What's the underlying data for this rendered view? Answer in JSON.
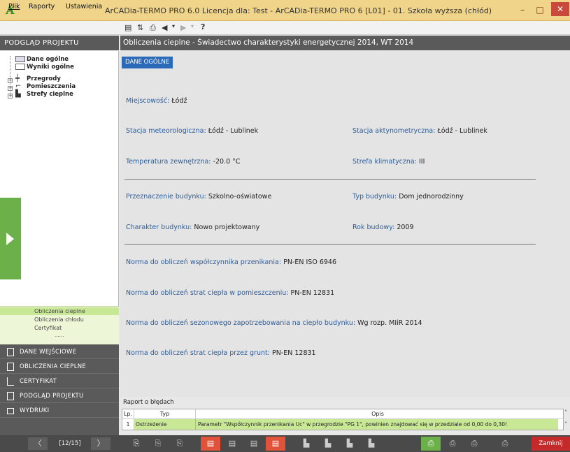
{
  "window": {
    "title": "ArCADia-TERMO PRO 6.0 Licencja dla: Test - ArCADia-TERMO PRO 6 [L01] - 01. Szkoła wyższa (chłód)",
    "minimize": "–",
    "maximize": "□",
    "close": "✕"
  },
  "menu": {
    "items": [
      "Plik",
      "Raporty",
      "Ustawienia"
    ]
  },
  "toolbar": {
    "icons": [
      "save-icon",
      "swap-icon",
      "preview-icon",
      "undo-icon",
      "undo-dropdown-icon",
      "redo-icon",
      "redo-dropdown-icon",
      "help-icon"
    ],
    "help_label": "?"
  },
  "sidebar": {
    "header": "PODGLĄD PROJEKTU",
    "tree": [
      {
        "label": "Dane ogólne",
        "icon": "table-icon"
      },
      {
        "label": "Wyniki ogólne",
        "icon": "chart-icon"
      },
      {
        "label": "Przegrody",
        "icon": "partition-icon"
      },
      {
        "label": "Pomieszczenia",
        "icon": "room-icon"
      },
      {
        "label": "Strefy cieplne",
        "icon": "zone-icon"
      }
    ],
    "sub_items": [
      "Obliczenia cieplne",
      "Obliczenia chłodu",
      "Certyfikat"
    ],
    "sub_more": "......",
    "nav": [
      {
        "label": "DANE WEJŚCIOWE",
        "icon": "input-data-icon"
      },
      {
        "label": "OBLICZENIA CIEPLNE",
        "icon": "calc-icon"
      },
      {
        "label": "CERTYFIKAT",
        "icon": "certificate-icon"
      },
      {
        "label": "PODGLĄD PROJEKTU",
        "icon": "preview-icon"
      },
      {
        "label": "WYDRUKI",
        "icon": "printer-icon"
      }
    ]
  },
  "content": {
    "header": "Obliczenia cieplne - Świadectwo charakterystyki energetycznej 2014, WT 2014",
    "tab": "DANE OGÓLNE",
    "fields": {
      "miejscowosc": {
        "label": "Miejscowość:",
        "value": "Łódź"
      },
      "stacja_met": {
        "label": "Stacja meteorologiczna:",
        "value": "Łódź - Lublinek"
      },
      "stacja_akt": {
        "label": "Stacja aktynometryczna:",
        "value": "Łódź - Lublinek"
      },
      "temp": {
        "label": "Temperatura zewnętrzna:",
        "value": "-20.0 °C"
      },
      "strefa": {
        "label": "Strefa klimatyczna:",
        "value": "III"
      },
      "przeznaczenie": {
        "label": "Przeznaczenie budynku:",
        "value": "Szkolno-oświatowe"
      },
      "typ": {
        "label": "Typ budynku:",
        "value": "Dom jednorodzinny"
      },
      "charakter": {
        "label": "Charakter budynku:",
        "value": "Nowo projektowany"
      },
      "rok": {
        "label": "Rok budowy:",
        "value": "2009"
      },
      "norma_u": {
        "label": "Norma do obliczeń współczynnika przenikania:",
        "value": "PN-EN ISO 6946"
      },
      "norma_straty": {
        "label": "Norma do obliczeń strat ciepła w pomieszczeniu:",
        "value": "PN-EN 12831"
      },
      "norma_sezon": {
        "label": "Norma do obliczeń sezonowego zapotrzebowania na ciepło budynku:",
        "value": "Wg rozp. MIiR 2014"
      },
      "norma_grunt": {
        "label": "Norma do obliczeń strat ciepła przez grunt:",
        "value": "PN-EN 12831"
      }
    }
  },
  "errors": {
    "title": "Raport o błędach",
    "headers": {
      "lp": "Lp.",
      "typ": "Typ",
      "opis": "Opis"
    },
    "rows": [
      {
        "lp": "1",
        "typ": "Ostrzeżenie",
        "opis": "Parametr \"Współczynnik przenikania Uc\" w przegrodzie \"PG 1\", powinien znajdować się w przedziale od 0,00 do 0,30!"
      }
    ]
  },
  "statusbar": {
    "prev": "〈",
    "next": "〉",
    "page": "[12/15]",
    "close_label": "Zamknij"
  },
  "colors": {
    "accent_green": "#6cb04a",
    "panel_dark": "#5a5a5a",
    "label_blue": "#2b5d9a",
    "tab_blue": "#2a6ab8",
    "close_red": "#c42a2a"
  }
}
